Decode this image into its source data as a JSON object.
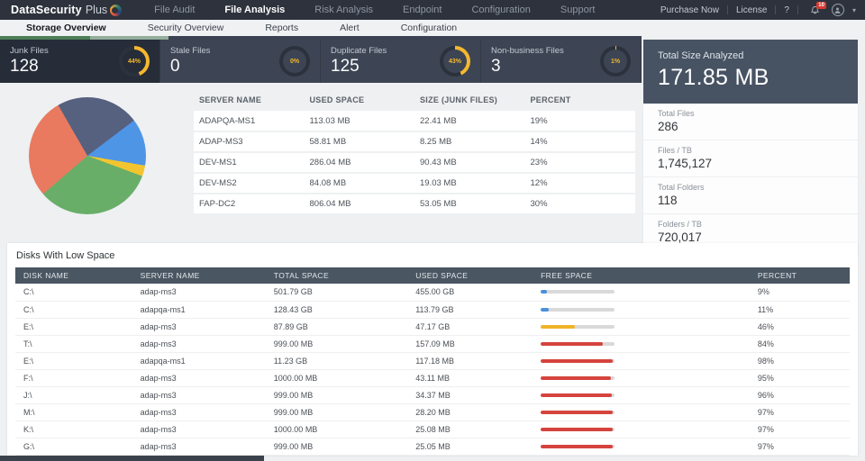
{
  "brand": {
    "name": "DataSecurity",
    "suffix": "Plus"
  },
  "topnav": {
    "items": [
      {
        "label": "File Audit",
        "active": false
      },
      {
        "label": "File Analysis",
        "active": true
      },
      {
        "label": "Risk Analysis",
        "active": false
      },
      {
        "label": "Endpoint",
        "active": false
      },
      {
        "label": "Configuration",
        "active": false
      },
      {
        "label": "Support",
        "active": false
      }
    ],
    "purchase_label": "Purchase Now",
    "license_label": "License",
    "help_label": "?",
    "bell_badge": "10"
  },
  "tabs": [
    {
      "label": "Storage Overview",
      "active": true
    },
    {
      "label": "Security Overview",
      "active": false
    },
    {
      "label": "Reports",
      "active": false
    },
    {
      "label": "Alert",
      "active": false
    },
    {
      "label": "Configuration",
      "active": false
    }
  ],
  "cards": [
    {
      "label": "Junk Files",
      "value": "128",
      "percent": 44,
      "percent_label": "44%",
      "selected": true
    },
    {
      "label": "Stale Files",
      "value": "0",
      "percent": 0,
      "percent_label": "0%",
      "selected": false
    },
    {
      "label": "Duplicate Files",
      "value": "125",
      "percent": 43,
      "percent_label": "43%",
      "selected": false
    },
    {
      "label": "Non-business Files",
      "value": "3",
      "percent": 1,
      "percent_label": "1%",
      "selected": false
    }
  ],
  "summary": {
    "title": "Total Size Analyzed",
    "value": "171.85 MB",
    "stats": [
      {
        "label": "Total Files",
        "value": "286"
      },
      {
        "label": "Files / TB",
        "value": "1,745,127"
      },
      {
        "label": "Total Folders",
        "value": "118"
      },
      {
        "label": "Folders / TB",
        "value": "720,017"
      }
    ]
  },
  "junk_table": {
    "columns": [
      "SERVER NAME",
      "USED SPACE",
      "SIZE (JUNK FILES)",
      "PERCENT"
    ],
    "rows": [
      [
        "ADAPQA-MS1",
        "113.03 MB",
        "22.41 MB",
        "19%"
      ],
      [
        "ADAP-MS3",
        "58.81 MB",
        "8.25 MB",
        "14%"
      ],
      [
        "DEV-MS1",
        "286.04 MB",
        "90.43 MB",
        "23%"
      ],
      [
        "DEV-MS2",
        "84.08 MB",
        "19.03 MB",
        "12%"
      ],
      [
        "FAP-DC2",
        "806.04 MB",
        "53.05 MB",
        "30%"
      ]
    ]
  },
  "disks": {
    "title": "Disks With Low Space",
    "columns": [
      "DISK NAME",
      "SERVER NAME",
      "TOTAL SPACE",
      "USED SPACE",
      "FREE SPACE",
      "PERCENT"
    ],
    "rows": [
      {
        "cells": [
          "C:\\",
          "adap-ms3",
          "501.79 GB",
          "455.00 GB"
        ],
        "percent": 9,
        "percent_label": "9%",
        "bar_color": "blue"
      },
      {
        "cells": [
          "C:\\",
          "adapqa-ms1",
          "128.43 GB",
          "113.79 GB"
        ],
        "percent": 11,
        "percent_label": "11%",
        "bar_color": "blue"
      },
      {
        "cells": [
          "E:\\",
          "adap-ms3",
          "87.89 GB",
          "47.17 GB"
        ],
        "percent": 46,
        "percent_label": "46%",
        "bar_color": "yellow"
      },
      {
        "cells": [
          "T:\\",
          "adap-ms3",
          "999.00 MB",
          "157.09 MB"
        ],
        "percent": 84,
        "percent_label": "84%",
        "bar_color": "red"
      },
      {
        "cells": [
          "E:\\",
          "adapqa-ms1",
          "11.23 GB",
          "117.18 MB"
        ],
        "percent": 98,
        "percent_label": "98%",
        "bar_color": "red"
      },
      {
        "cells": [
          "F:\\",
          "adap-ms3",
          "1000.00 MB",
          "43.11 MB"
        ],
        "percent": 95,
        "percent_label": "95%",
        "bar_color": "red"
      },
      {
        "cells": [
          "J:\\",
          "adap-ms3",
          "999.00 MB",
          "34.37 MB"
        ],
        "percent": 96,
        "percent_label": "96%",
        "bar_color": "red"
      },
      {
        "cells": [
          "M:\\",
          "adap-ms3",
          "999.00 MB",
          "28.20 MB"
        ],
        "percent": 97,
        "percent_label": "97%",
        "bar_color": "red"
      },
      {
        "cells": [
          "K:\\",
          "adap-ms3",
          "1000.00 MB",
          "25.08 MB"
        ],
        "percent": 97,
        "percent_label": "97%",
        "bar_color": "red"
      },
      {
        "cells": [
          "G:\\",
          "adap-ms3",
          "999.00 MB",
          "25.05 MB"
        ],
        "percent": 97,
        "percent_label": "97%",
        "bar_color": "red"
      }
    ]
  },
  "colors": {
    "accent_green": "#4e7e56",
    "gauge_arc": "#f5b82e",
    "gauge_track": "#2b323e",
    "bar_blue": "#4a90d9",
    "bar_yellow": "#f0b429",
    "bar_red": "#d5433d"
  },
  "chart_data": {
    "type": "pie",
    "title": "",
    "legend": "none",
    "start_angle_deg": -30,
    "slices": [
      {
        "label": "slice-1",
        "value": 23,
        "color": "#566180"
      },
      {
        "label": "slice-2",
        "value": 13,
        "color": "#4e95e6"
      },
      {
        "label": "slice-3",
        "value": 3,
        "color": "#f2c52f"
      },
      {
        "label": "slice-4",
        "value": 33,
        "color": "#68ae68"
      },
      {
        "label": "slice-5",
        "value": 28,
        "color": "#e97a5f"
      }
    ]
  }
}
